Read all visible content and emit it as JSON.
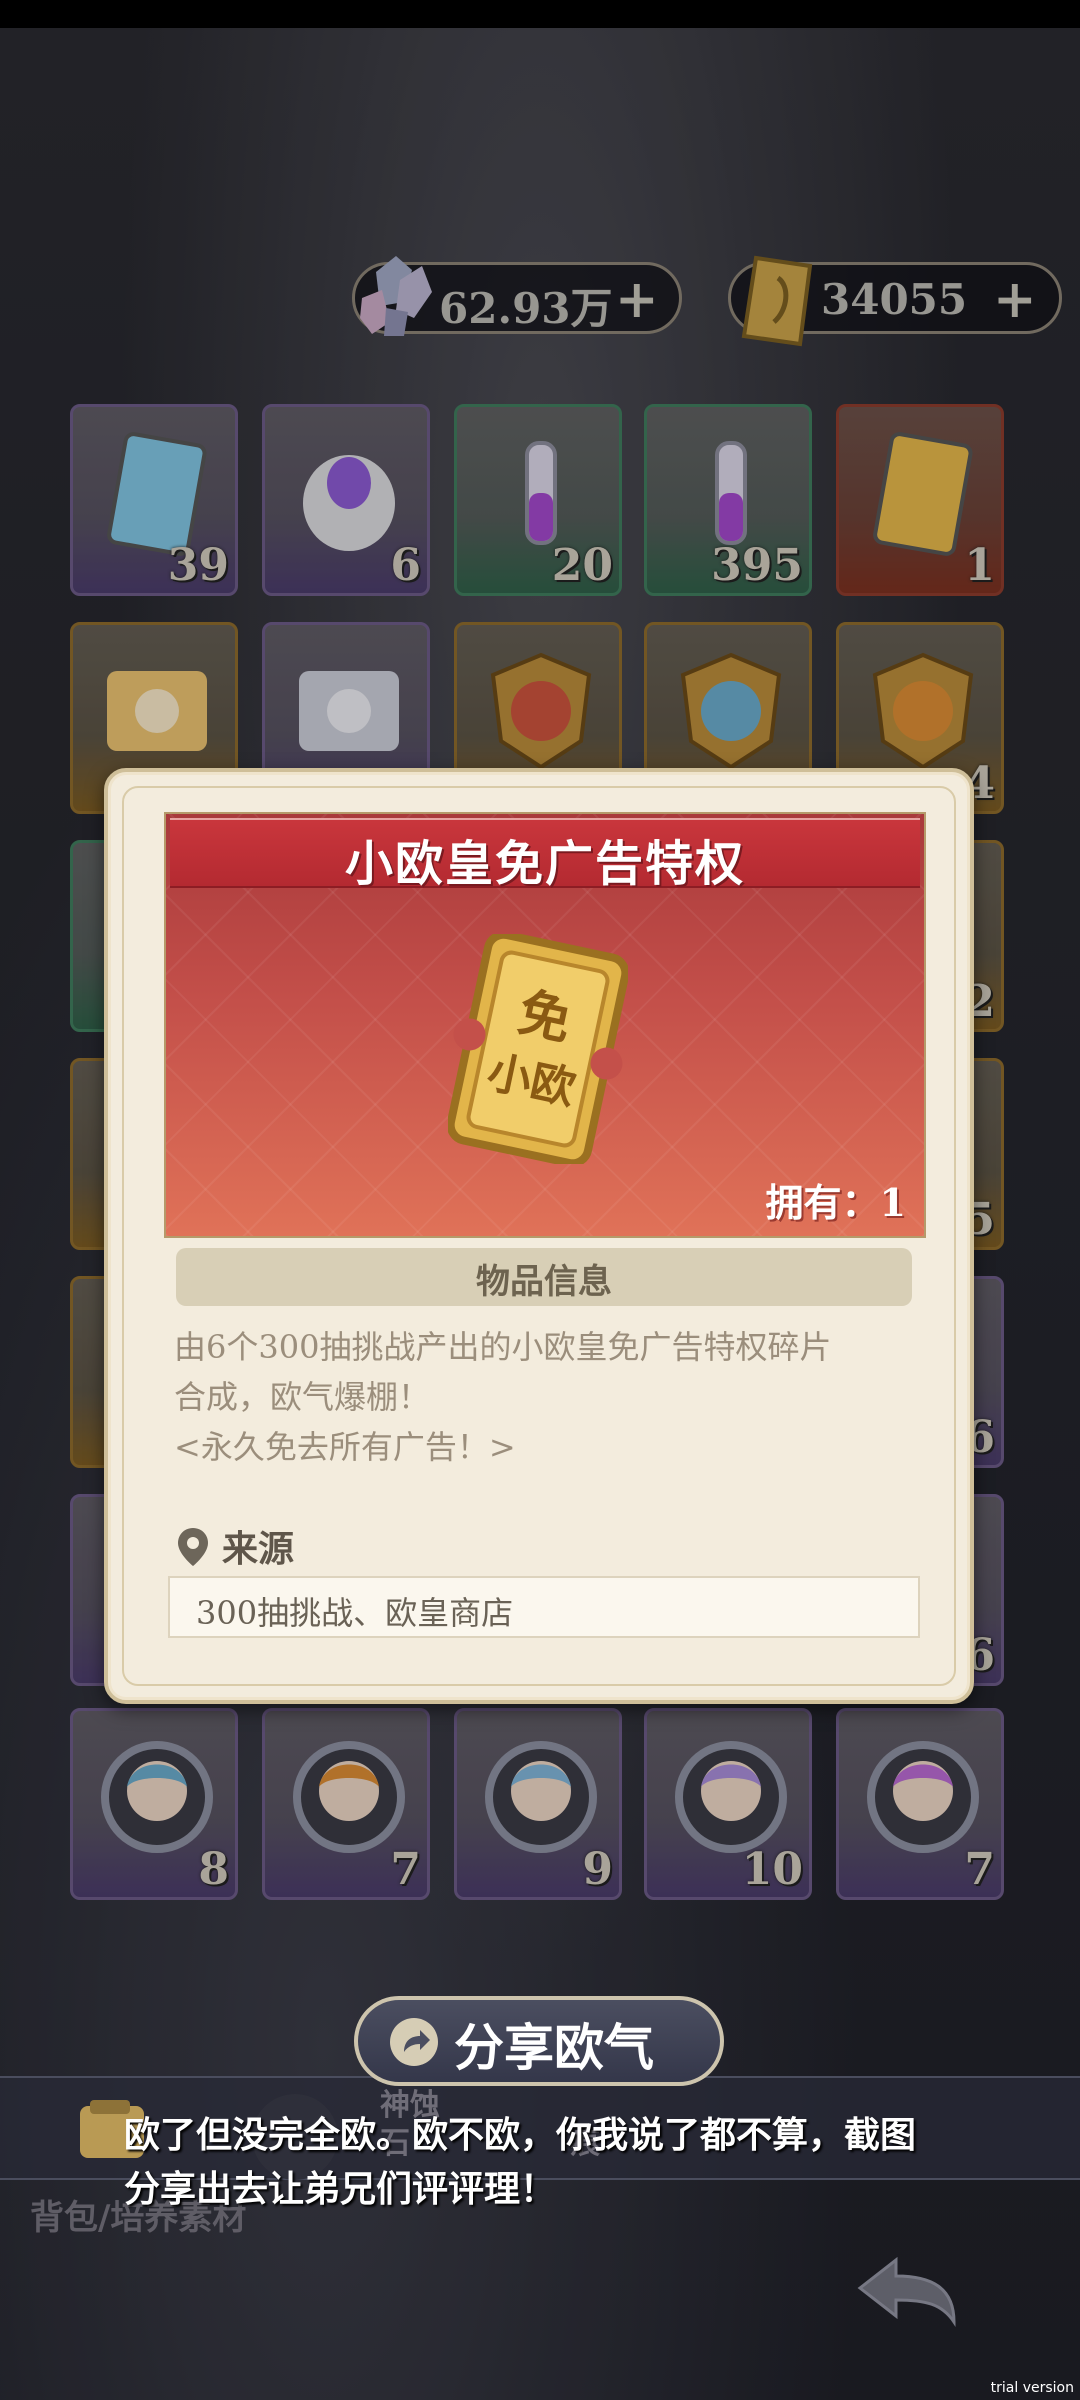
{
  "currency": {
    "crystals": "62.93万",
    "tickets": "34055",
    "plus": "+"
  },
  "grid": [
    {
      "name": "ticket-xiaofei",
      "count": "39",
      "style": "purple"
    },
    {
      "name": "purple-egg",
      "count": "6",
      "style": "purple"
    },
    {
      "name": "potion-small",
      "count": "20",
      "style": "green"
    },
    {
      "name": "potion-double",
      "count": "395",
      "style": "green"
    },
    {
      "name": "ticket-xiaoou",
      "count": "1",
      "style": "red"
    },
    {
      "name": "scroll-gold",
      "count": "",
      "style": "gold"
    },
    {
      "name": "scroll-silver",
      "count": "",
      "style": "purple"
    },
    {
      "name": "badge-red",
      "count": "",
      "style": "gold"
    },
    {
      "name": "badge-blue",
      "count": "",
      "style": "gold"
    },
    {
      "name": "badge-orange",
      "count": "4",
      "style": "gold"
    },
    {
      "name": "hidden-1",
      "count": "",
      "style": "green"
    },
    {
      "name": "hidden-2",
      "count": "2",
      "style": "gold"
    },
    {
      "name": "hidden-3",
      "count": "",
      "style": "gold"
    },
    {
      "name": "hidden-4",
      "count": "5",
      "style": "gold"
    },
    {
      "name": "hidden-5",
      "count": "",
      "style": "gold"
    },
    {
      "name": "hidden-6",
      "count": "6",
      "style": "purple"
    },
    {
      "name": "hidden-7",
      "count": "",
      "style": "purple"
    },
    {
      "name": "hidden-8",
      "count": "6",
      "style": "purple"
    },
    {
      "name": "character-white-hair",
      "count": "8",
      "style": "purple"
    },
    {
      "name": "character-dark-skin",
      "count": "7",
      "style": "purple"
    },
    {
      "name": "character-purple-hair",
      "count": "9",
      "style": "purple"
    },
    {
      "name": "character-orange-hair",
      "count": "10",
      "style": "purple"
    },
    {
      "name": "character-blonde",
      "count": "7",
      "style": "purple"
    }
  ],
  "modal": {
    "title": "小欧皇免广告特权",
    "ticket_text_top": "免",
    "ticket_text_bottom": "小欧",
    "own": "拥有：1",
    "section_title": "物品信息",
    "desc_line1": "由6个300抽挑战产出的小欧皇免广告特权碎片",
    "desc_line2": "合成，欧气爆棚！",
    "desc_line3": "<永久免去所有广告！>",
    "source_label": "来源",
    "source_value": "300抽挑战、欧皇商店"
  },
  "share": {
    "label": "分享欧气",
    "caption_line1": "欧了但没完全欧。欧不欧，你我说了都不算，截图",
    "caption_line2": "分享出去让弟兄们评评理！"
  },
  "bottom": {
    "tab_partial_1": "神蚀",
    "tab_partial_2": "石",
    "tab_partial_3": "痕",
    "breadcrumb": "背包/培养素材"
  },
  "watermark": "trial version",
  "colors": {
    "banner_red": "#c4504a",
    "modal_bg": "#f3ecdd",
    "title_red": "#b42a31"
  }
}
